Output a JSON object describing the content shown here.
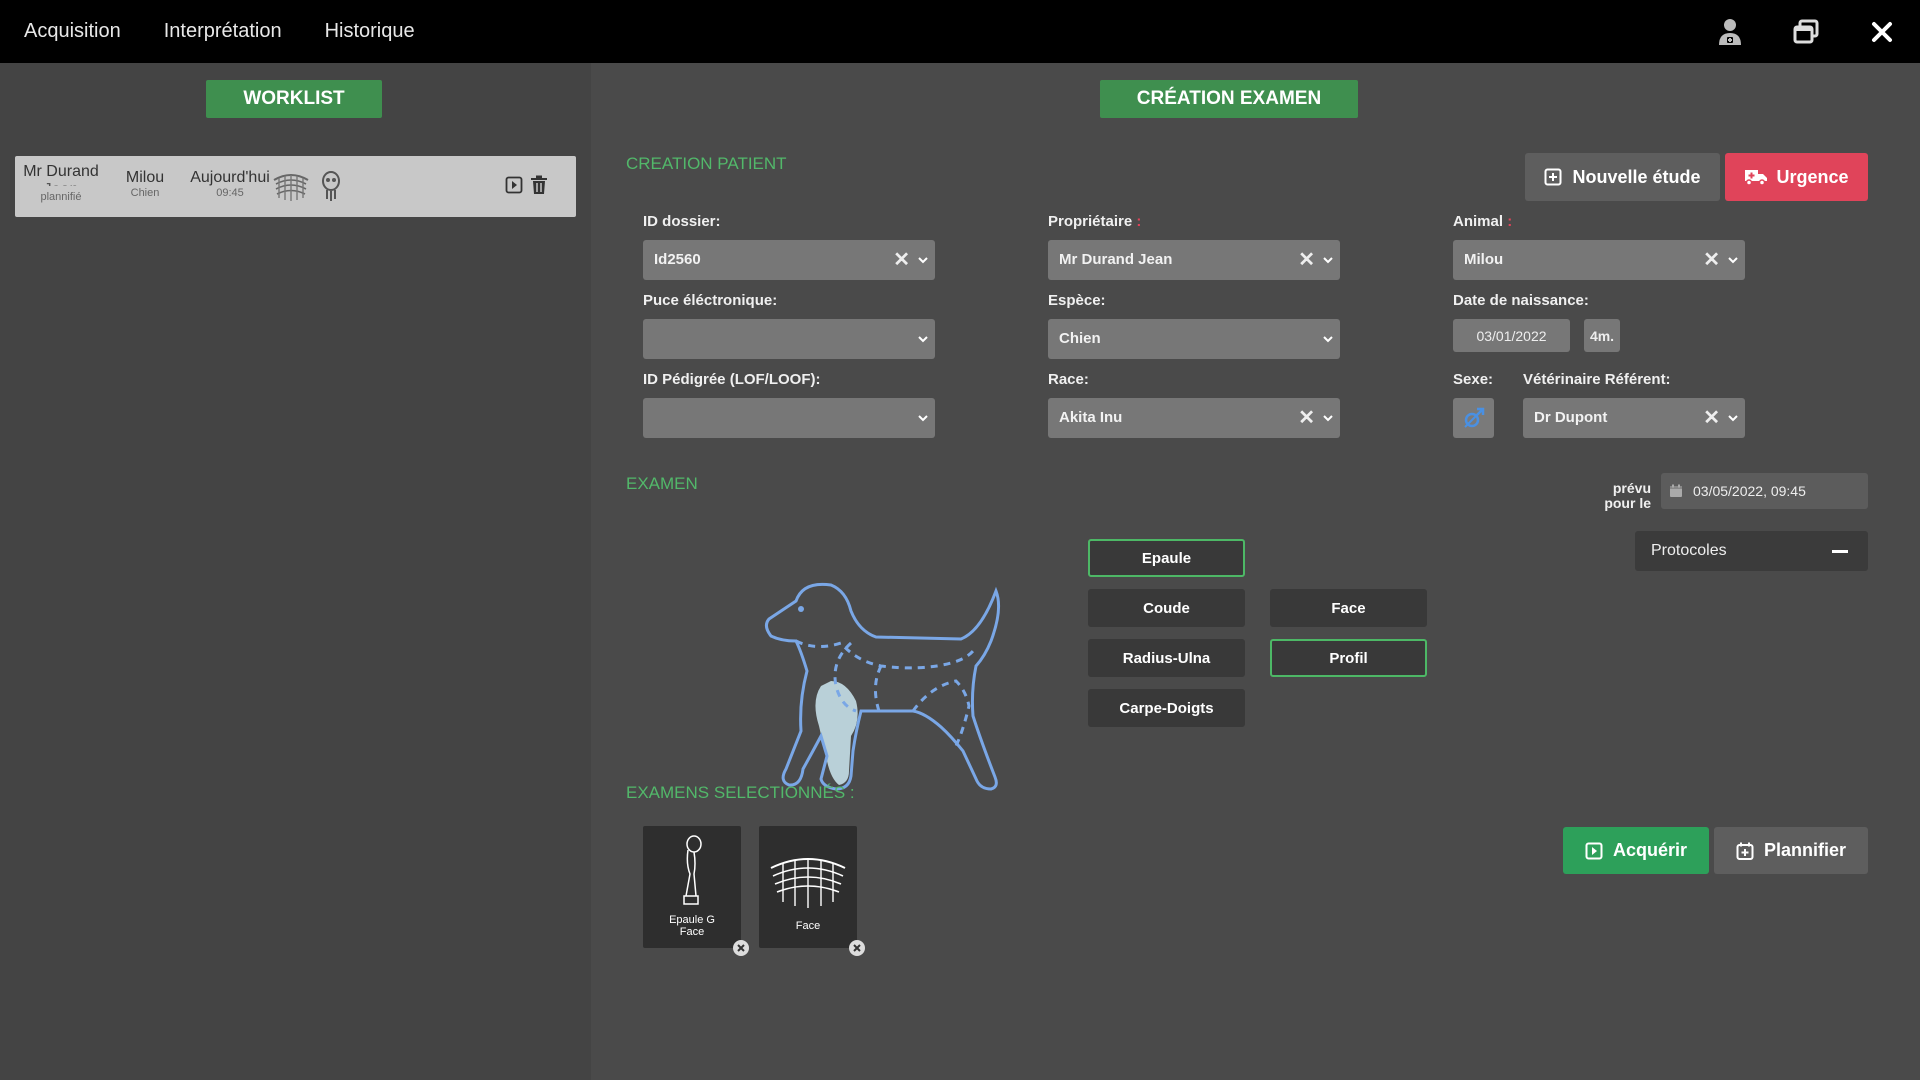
{
  "menu": [
    "Acquisition",
    "Interprétation",
    "Historique"
  ],
  "window_icons": [
    "doctor-icon",
    "restore-windows-icon",
    "close-icon"
  ],
  "worklist": {
    "title": "WORKLIST",
    "row": {
      "owner": "Mr Durand",
      "owner_cut": "Jean",
      "status": "plannifié",
      "animal": "Milou",
      "species": "Chien",
      "date": "Aujourd'hui",
      "time": "09:45"
    }
  },
  "creation": {
    "title": "CRÉATION EXAMEN",
    "patient_section": "CREATION PATIENT",
    "nouvelle_etude": "Nouvelle étude",
    "urgence": "Urgence",
    "fields": {
      "id_dossier": {
        "label": "ID dossier:",
        "value": "Id2560"
      },
      "puce": {
        "label": "Puce éléctronique:",
        "value": ""
      },
      "pedigree": {
        "label": "ID Pédigrée (LOF/LOOF):",
        "value": ""
      },
      "proprietaire": {
        "label": "Propriétaire",
        "value": "Mr Durand Jean"
      },
      "espece": {
        "label": "Espèce:",
        "value": "Chien"
      },
      "race": {
        "label": "Race:",
        "value": "Akita Inu"
      },
      "animal": {
        "label": "Animal",
        "value": "Milou"
      },
      "naissance": {
        "label": "Date de naissance:",
        "value": "03/01/2022",
        "age": "4m."
      },
      "sexe": {
        "label": "Sexe:"
      },
      "veterinaire": {
        "label": "Vétérinaire Référent:",
        "value": "Dr Dupont"
      }
    },
    "required_mark": ":",
    "exam_section": "EXAMEN",
    "prevu_line1": "prévu",
    "prevu_line2": "pour le",
    "prevu_date": "03/05/2022, 09:45",
    "protocoles": "Protocoles",
    "exam_buttons": {
      "epaule": "Epaule",
      "coude": "Coude",
      "radius": "Radius-Ulna",
      "carpe": "Carpe-Doigts",
      "face": "Face",
      "profil": "Profil"
    },
    "selected_section": "EXAMENS SELECTIONNÉS :",
    "selected": [
      {
        "line1": "Epaule G",
        "line2": "Face"
      },
      {
        "line1": "Face"
      }
    ],
    "acquerir": "Acquérir",
    "planifier": "Plannifier"
  },
  "colors": {
    "accent_green": "#52b86a",
    "urgence_red": "#e0445a",
    "diagram_blue": "#7aa7e6"
  }
}
